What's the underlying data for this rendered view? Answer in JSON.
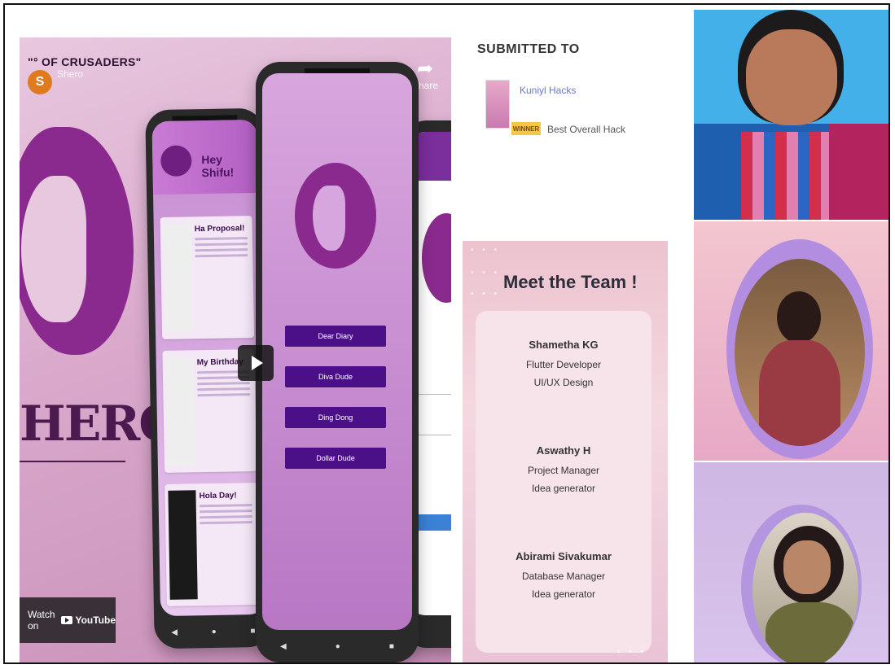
{
  "video": {
    "title": "\"° OF CRUSADERS\"",
    "channel_initial": "S",
    "channel_name": "Shero",
    "share_label": "Share",
    "logo_text": "HERO",
    "watch_label": "Watch on",
    "youtube_label": "YouTube",
    "phone1": {
      "greeting": "Hey Shifu!",
      "cards": [
        "Ha Proposal!",
        "My Birthday",
        "Hola Day!"
      ]
    },
    "phone2": {
      "buttons": [
        "Dear Diary",
        "Diva Dude",
        "Ding Dong",
        "Dollar Dude"
      ]
    }
  },
  "submitted": {
    "heading": "SUBMITTED TO",
    "hackathon": "Kuniyl Hacks",
    "badge": "WINNER",
    "award": "Best Overall Hack"
  },
  "team": {
    "title": "Meet the Team !",
    "members": [
      {
        "name": "Shametha KG",
        "roles": [
          "Flutter Developer",
          "UI/UX Design"
        ]
      },
      {
        "name": "Aswathy H",
        "roles": [
          "Project Manager",
          "Idea generator"
        ]
      },
      {
        "name": "Abirami Sivakumar",
        "roles": [
          "Database Manager",
          "Idea generator"
        ]
      }
    ]
  },
  "colors": {
    "brand_purple": "#8a2a8e",
    "button_purple": "#4b0f87",
    "winner_yellow": "#f4c842"
  }
}
